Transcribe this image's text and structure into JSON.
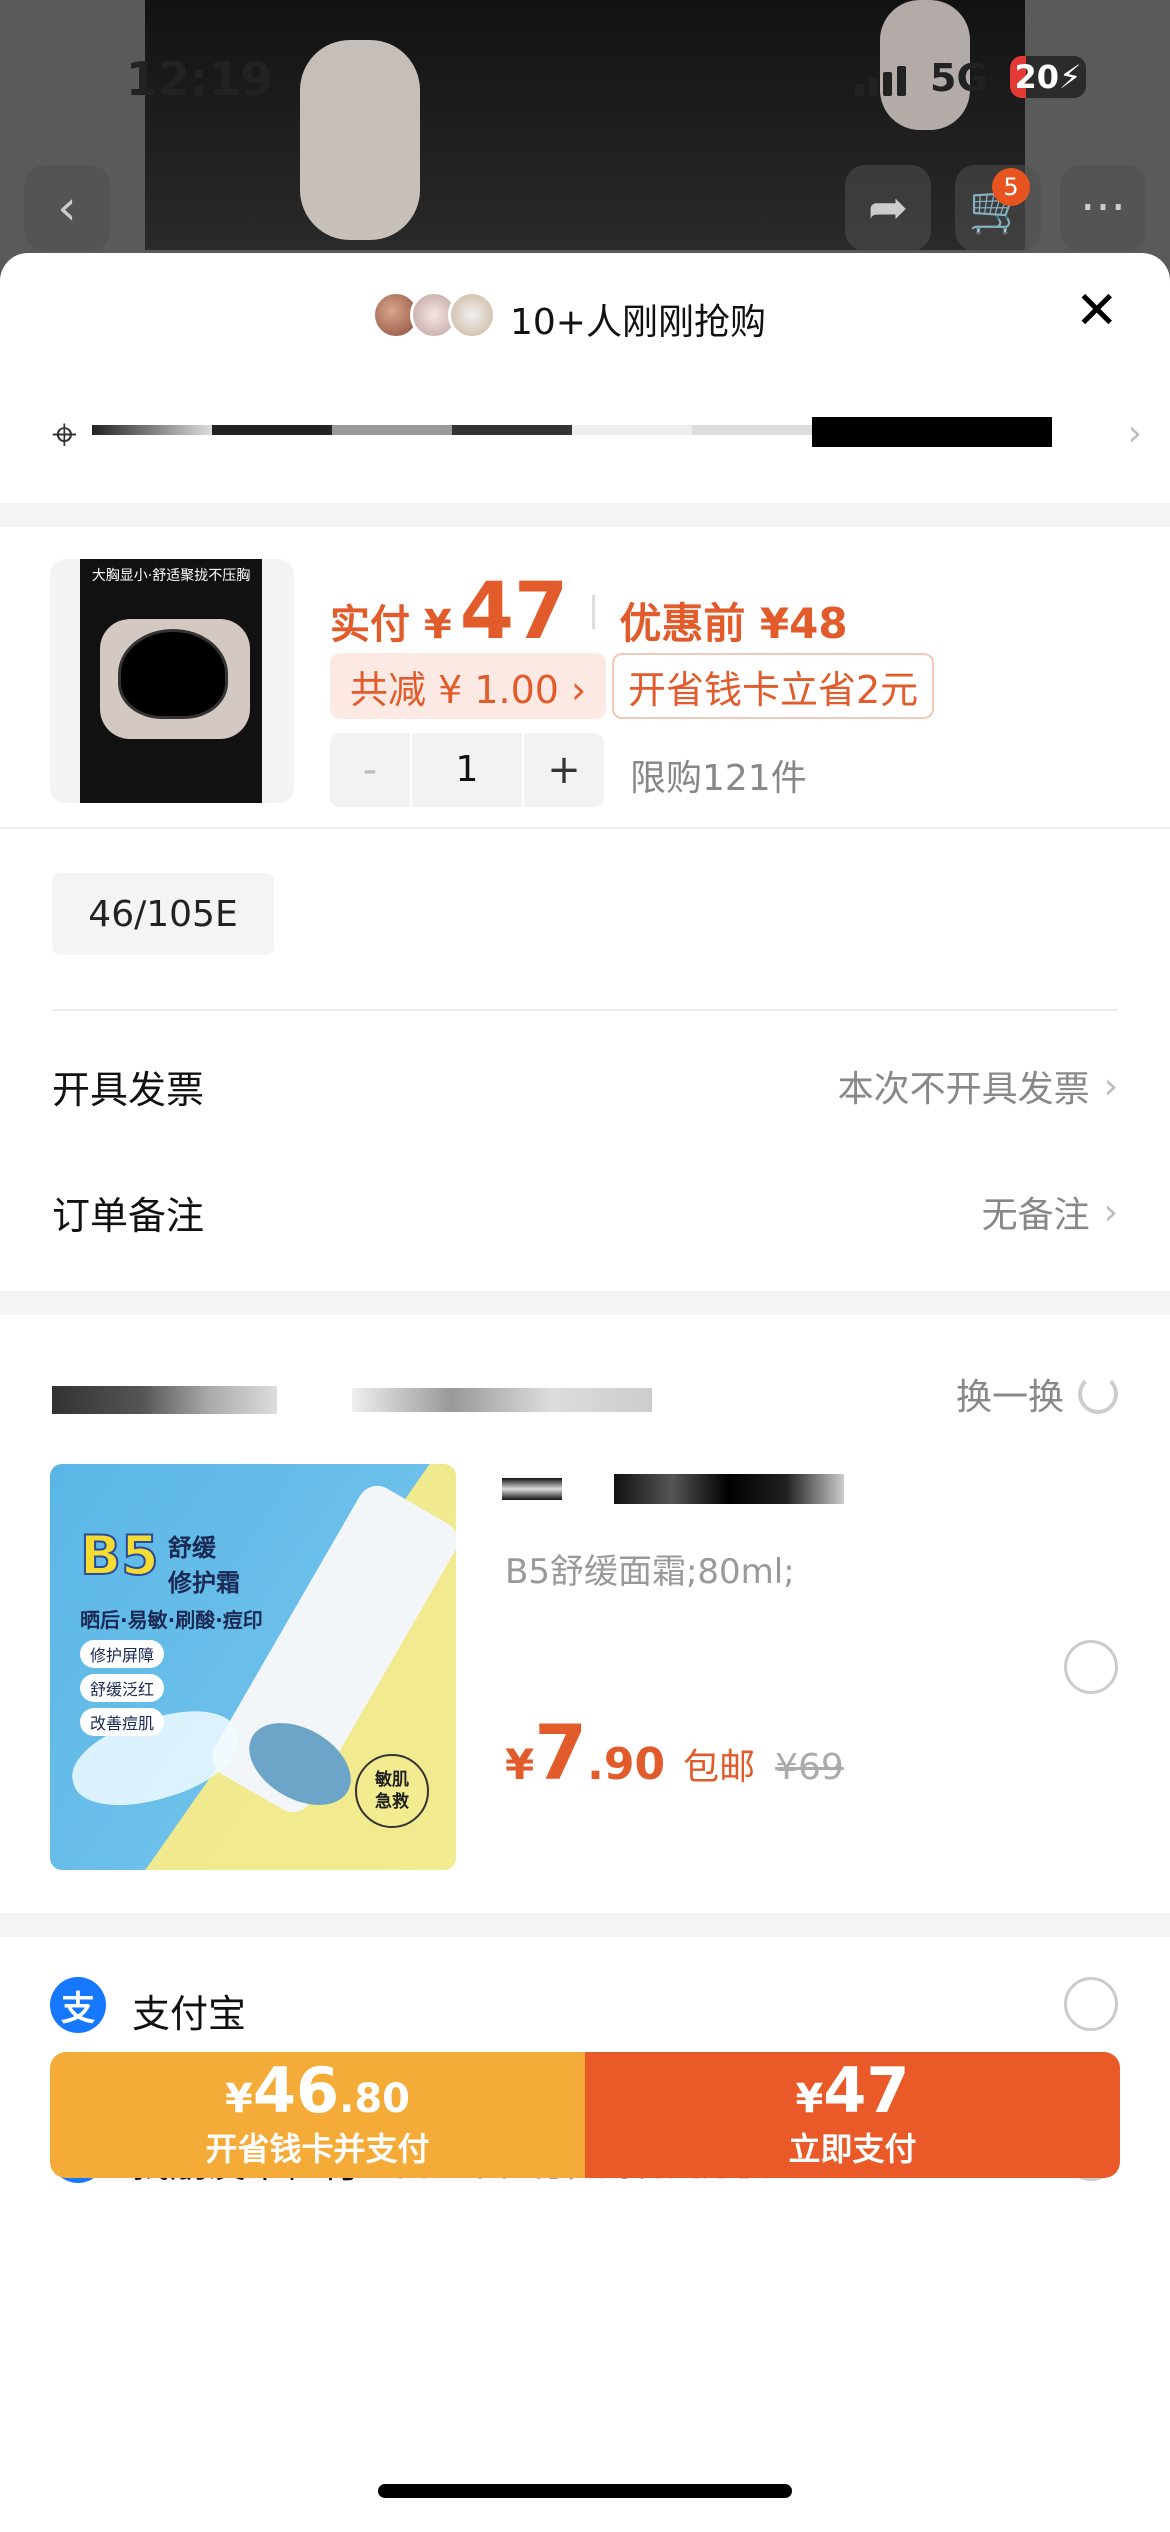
{
  "status_bar": {
    "time": "12:19",
    "network": "5G",
    "battery": "20"
  },
  "cart_badge": "5",
  "sheet": {
    "buyers_text": "10+人刚刚抢购",
    "product": {
      "pay_label": "实付 ¥",
      "pay_price": "47",
      "original_label": "优惠前 ¥48",
      "discount_tag": "共减 ¥ 1.00 ›",
      "card_tag": "开省钱卡立省2元",
      "qty_minus": "-",
      "qty": "1",
      "qty_plus": "+",
      "limit": "限购121件",
      "thumb_caption": "大胸显小·舒适聚拢不压胸"
    },
    "size_chip": "46/105E",
    "invoice": {
      "label": "开具发票",
      "value": "本次不开具发票"
    },
    "remark": {
      "label": "订单备注",
      "value": "无备注"
    },
    "recommend": {
      "swap_label": "换一换",
      "spec": "B5舒缓面霜;80ml;",
      "price_currency": "¥",
      "price_int": "7",
      "price_dec": ".90",
      "free_ship": "包邮",
      "original": "¥69",
      "card_b5": "B5",
      "card_title": "舒缓\n修护霜",
      "card_sub": "晒后·易敏·刷酸·痘印",
      "card_chips": [
        "修护屏障",
        "舒缓泛红",
        "改善痘肌"
      ],
      "card_seal": "敏肌\n急救"
    },
    "payments": [
      {
        "name": "支付宝",
        "icon": "支"
      },
      {
        "name": "找朋友帮忙付",
        "sub": "找人帮忙付，购物更方便",
        "icon": "$"
      }
    ],
    "buttons": {
      "left_currency": "¥",
      "left_int": "46",
      "left_dec": ".80",
      "left_label": "开省钱卡并支付",
      "right_currency": "¥",
      "right_int": "47",
      "right_label": "立即支付"
    }
  },
  "colors": {
    "accent": "#e25b2a",
    "pay_button": "#ea5a28",
    "card_button": "#f5ab37",
    "alipay": "#1677ff"
  }
}
